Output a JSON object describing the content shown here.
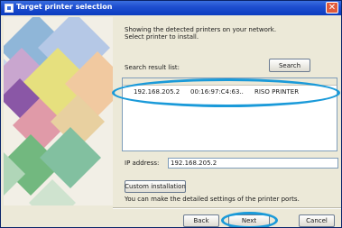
{
  "window": {
    "title": "Target printer selection",
    "close_symbol": "✕"
  },
  "intro_lines": [
    "Showing the detected printers on your network.",
    "Select printer to install."
  ],
  "search": {
    "label": "Search result list:",
    "button": "Search"
  },
  "printers": [
    {
      "ip": "192.168.205.2",
      "mac": "00:16:97:C4:63..",
      "name": "RISO PRINTER"
    }
  ],
  "ip_address": {
    "label": "IP address:",
    "value": "192.168.205.2"
  },
  "custom": {
    "button": "Custom installation",
    "note": "You can make the detailed settings of the printer ports."
  },
  "footer": {
    "back": "Back",
    "next": "Next",
    "cancel": "Cancel"
  },
  "highlight_color": "#1a9ad9"
}
